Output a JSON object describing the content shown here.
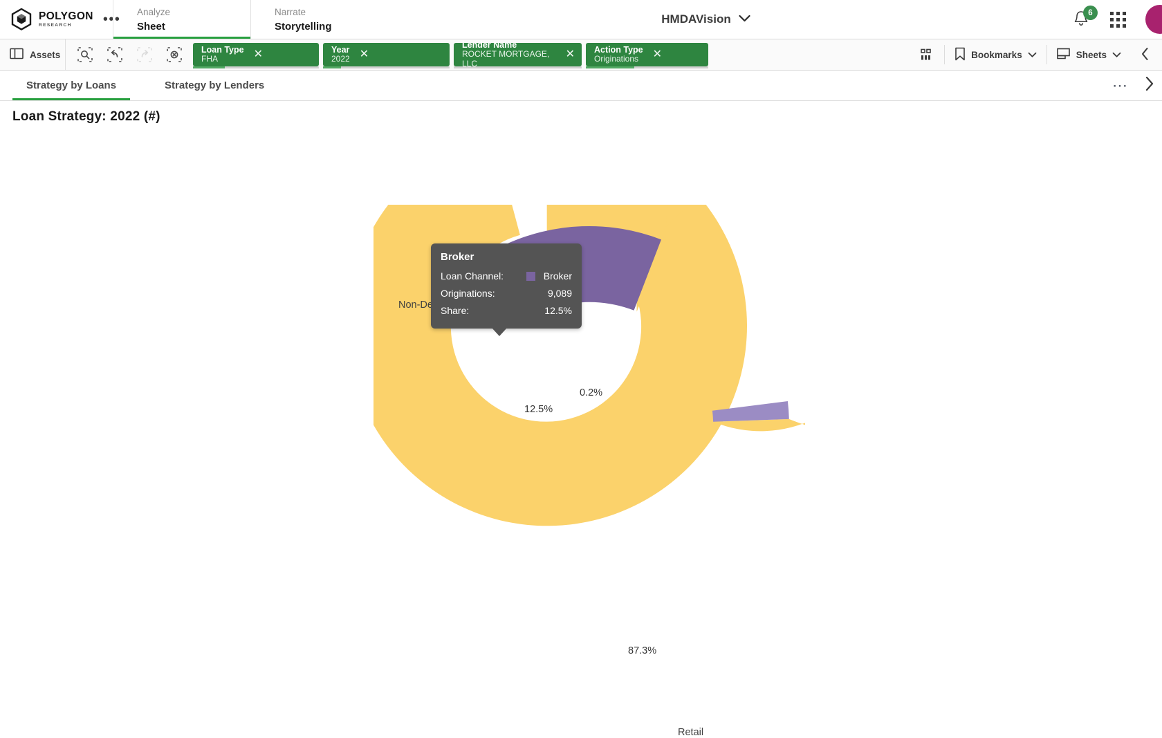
{
  "brand": {
    "name": "POLYGON",
    "sub": "RESEARCH",
    "menu_dots": "•••",
    "logo_icon": "polygon-hexagon-logo"
  },
  "topnav": {
    "items": [
      {
        "sub": "Analyze",
        "main": "Sheet",
        "active": true
      },
      {
        "sub": "Narrate",
        "main": "Storytelling",
        "active": false
      }
    ],
    "app_title": "HMDAVision",
    "app_title_caret": "chevron-down-icon",
    "notification_count": "6",
    "notification_icon": "bell-icon",
    "apps_icon": "apps-grid-icon",
    "avatar_icon": "user-avatar"
  },
  "selection_bar": {
    "assets_label": "Assets",
    "assets_icon": "panel-layout-icon",
    "tools": [
      {
        "name": "selection-search-icon",
        "disabled": false
      },
      {
        "name": "step-back-icon",
        "disabled": false
      },
      {
        "name": "step-forward-icon",
        "disabled": true
      },
      {
        "name": "clear-all-selections-icon",
        "disabled": false
      }
    ],
    "chips": [
      {
        "title": "Loan Type",
        "value": "FHA"
      },
      {
        "title": "Year",
        "value": "2022"
      },
      {
        "title": "Lender Name",
        "value": "ROCKET MORTGAGE, LLC"
      },
      {
        "title": "Action Type",
        "value": "Originations"
      }
    ],
    "right": {
      "chart_icon": "chart-bars-icon",
      "bookmarks_label": "Bookmarks",
      "bookmarks_icon": "bookmark-icon",
      "sheets_label": "Sheets",
      "sheets_icon": "sheets-icon",
      "collapse_icon": "chevron-left-icon"
    }
  },
  "sheet_tabs": {
    "tabs": [
      {
        "label": "Strategy by Loans",
        "active": true
      },
      {
        "label": "Strategy by Lenders",
        "active": false
      }
    ],
    "more_icon": "ellipsis-horizontal-icon",
    "expand_icon": "chevron-right-icon"
  },
  "visualization": {
    "title": "Loan Strategy: 2022 (#)",
    "legend_title": "Loan Channel",
    "legend_caret": "chevron-down-icon"
  },
  "tooltip": {
    "title": "Broker",
    "rows": [
      {
        "key": "Loan Channel:",
        "value": "Broker",
        "swatch": "#7a64a0"
      },
      {
        "key": "Originations:",
        "value": "9,089",
        "swatch": null
      },
      {
        "key": "Share:",
        "value": "12.5%",
        "swatch": null
      }
    ]
  },
  "colors": {
    "brand_green": "#2e8540",
    "accent_green": "#28a03f",
    "retail_yellow": "#fbd26b",
    "broker_purple": "#7a64a0",
    "ndc_purple": "#9b8cc4",
    "tooltip_bg": "#545454",
    "avatar_magenta": "#a8226e"
  },
  "chart_data": {
    "type": "pie",
    "title": "Loan Strategy: 2022 (#)",
    "subtitle": "Loan Channel",
    "donut": true,
    "inner_radius_ratio": 0.62,
    "categories": [
      "Retail",
      "Broker",
      "Non-Delegated Correspondent"
    ],
    "values": [
      87.3,
      12.5,
      0.2
    ],
    "value_unit": "%",
    "data_labels": [
      "87.3%",
      "12.5%",
      "0.2%"
    ],
    "colors": [
      "#fbd26b",
      "#7a64a0",
      "#9b8cc4"
    ],
    "legend_title": "Loan Channel",
    "legend_position": "top-right",
    "highlighted_slice": "Broker",
    "highlighted_slice_count": "9,089",
    "start_angle_deg": -4,
    "measure": "Originations"
  }
}
